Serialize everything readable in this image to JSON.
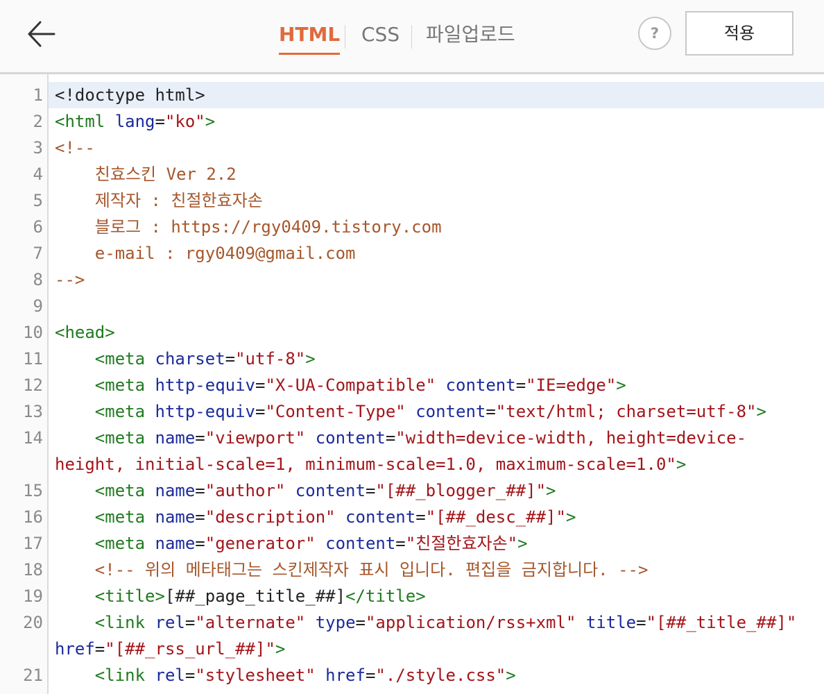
{
  "header": {
    "tabs": [
      "HTML",
      "CSS",
      "파일업로드"
    ],
    "help_label": "?",
    "apply_label": "적용"
  },
  "editor": {
    "line_numbers": [
      "1",
      "2",
      "3",
      "4",
      "5",
      "6",
      "7",
      "8",
      "9",
      "10",
      "11",
      "12",
      "13",
      "14",
      "15",
      "16",
      "17",
      "18",
      "19",
      "20",
      "21"
    ],
    "lines": [
      [
        {
          "t": "<!doctype html>",
          "c": "tx"
        }
      ],
      [
        {
          "t": "<html ",
          "c": "tg"
        },
        {
          "t": "lang",
          "c": "at"
        },
        {
          "t": "=",
          "c": "tx"
        },
        {
          "t": "\"ko\"",
          "c": "st"
        },
        {
          "t": ">",
          "c": "tg"
        }
      ],
      [
        {
          "t": "<!--",
          "c": "cm"
        }
      ],
      [
        {
          "t": "    친효스킨 Ver 2.2",
          "c": "cm"
        }
      ],
      [
        {
          "t": "    제작자 : 친절한효자손",
          "c": "cm"
        }
      ],
      [
        {
          "t": "    블로그 : https://rgy0409.tistory.com",
          "c": "cm"
        }
      ],
      [
        {
          "t": "    e-mail : rgy0409@gmail.com",
          "c": "cm"
        }
      ],
      [
        {
          "t": "-->",
          "c": "cm"
        }
      ],
      [],
      [
        {
          "t": "<head>",
          "c": "tg"
        }
      ],
      [
        {
          "t": "    <meta ",
          "c": "tg"
        },
        {
          "t": "charset",
          "c": "at"
        },
        {
          "t": "=",
          "c": "tx"
        },
        {
          "t": "\"utf-8\"",
          "c": "st"
        },
        {
          "t": ">",
          "c": "tg"
        }
      ],
      [
        {
          "t": "    <meta ",
          "c": "tg"
        },
        {
          "t": "http-equiv",
          "c": "at"
        },
        {
          "t": "=",
          "c": "tx"
        },
        {
          "t": "\"X-UA-Compatible\"",
          "c": "st"
        },
        {
          "t": " content",
          "c": "at"
        },
        {
          "t": "=",
          "c": "tx"
        },
        {
          "t": "\"IE=edge\"",
          "c": "st"
        },
        {
          "t": ">",
          "c": "tg"
        }
      ],
      [
        {
          "t": "    <meta ",
          "c": "tg"
        },
        {
          "t": "http-equiv",
          "c": "at"
        },
        {
          "t": "=",
          "c": "tx"
        },
        {
          "t": "\"Content-Type\"",
          "c": "st"
        },
        {
          "t": " content",
          "c": "at"
        },
        {
          "t": "=",
          "c": "tx"
        },
        {
          "t": "\"text/html; charset=utf-8\"",
          "c": "st"
        },
        {
          "t": ">",
          "c": "tg"
        }
      ],
      [
        {
          "t": "    <meta ",
          "c": "tg"
        },
        {
          "t": "name",
          "c": "at"
        },
        {
          "t": "=",
          "c": "tx"
        },
        {
          "t": "\"viewport\"",
          "c": "st"
        },
        {
          "t": " content",
          "c": "at"
        },
        {
          "t": "=",
          "c": "tx"
        },
        {
          "t": "\"width=device-width, height=device-",
          "c": "st"
        }
      ],
      [
        {
          "t": "height, initial-scale=1, minimum-scale=1.0, maximum-scale=1.0\"",
          "c": "st"
        },
        {
          "t": ">",
          "c": "tg"
        }
      ],
      [
        {
          "t": "    <meta ",
          "c": "tg"
        },
        {
          "t": "name",
          "c": "at"
        },
        {
          "t": "=",
          "c": "tx"
        },
        {
          "t": "\"author\"",
          "c": "st"
        },
        {
          "t": " content",
          "c": "at"
        },
        {
          "t": "=",
          "c": "tx"
        },
        {
          "t": "\"[##_blogger_##]\"",
          "c": "st"
        },
        {
          "t": ">",
          "c": "tg"
        }
      ],
      [
        {
          "t": "    <meta ",
          "c": "tg"
        },
        {
          "t": "name",
          "c": "at"
        },
        {
          "t": "=",
          "c": "tx"
        },
        {
          "t": "\"description\"",
          "c": "st"
        },
        {
          "t": " content",
          "c": "at"
        },
        {
          "t": "=",
          "c": "tx"
        },
        {
          "t": "\"[##_desc_##]\"",
          "c": "st"
        },
        {
          "t": ">",
          "c": "tg"
        }
      ],
      [
        {
          "t": "    <meta ",
          "c": "tg"
        },
        {
          "t": "name",
          "c": "at"
        },
        {
          "t": "=",
          "c": "tx"
        },
        {
          "t": "\"generator\"",
          "c": "st"
        },
        {
          "t": " content",
          "c": "at"
        },
        {
          "t": "=",
          "c": "tx"
        },
        {
          "t": "\"친절한효자손\"",
          "c": "st"
        },
        {
          "t": ">",
          "c": "tg"
        }
      ],
      [
        {
          "t": "    <!-- 위의 메타태그는 스킨제작자 표시 입니다. 편집을 금지합니다. -->",
          "c": "cm"
        }
      ],
      [
        {
          "t": "    <title>",
          "c": "tg"
        },
        {
          "t": "[##_page_title_##]",
          "c": "tx"
        },
        {
          "t": "</title>",
          "c": "tg"
        }
      ],
      [
        {
          "t": "    <link ",
          "c": "tg"
        },
        {
          "t": "rel",
          "c": "at"
        },
        {
          "t": "=",
          "c": "tx"
        },
        {
          "t": "\"alternate\"",
          "c": "st"
        },
        {
          "t": " type",
          "c": "at"
        },
        {
          "t": "=",
          "c": "tx"
        },
        {
          "t": "\"application/rss+xml\"",
          "c": "st"
        },
        {
          "t": " title",
          "c": "at"
        },
        {
          "t": "=",
          "c": "tx"
        },
        {
          "t": "\"[##_title_##]\"",
          "c": "st"
        }
      ],
      [
        {
          "t": "href",
          "c": "at"
        },
        {
          "t": "=",
          "c": "tx"
        },
        {
          "t": "\"[##_rss_url_##]\"",
          "c": "st"
        },
        {
          "t": ">",
          "c": "tg"
        }
      ],
      [
        {
          "t": "    <link ",
          "c": "tg"
        },
        {
          "t": "rel",
          "c": "at"
        },
        {
          "t": "=",
          "c": "tx"
        },
        {
          "t": "\"stylesheet\"",
          "c": "st"
        },
        {
          "t": " href",
          "c": "at"
        },
        {
          "t": "=",
          "c": "tx"
        },
        {
          "t": "\"./style.css\"",
          "c": "st"
        },
        {
          "t": ">",
          "c": "tg"
        }
      ]
    ]
  }
}
